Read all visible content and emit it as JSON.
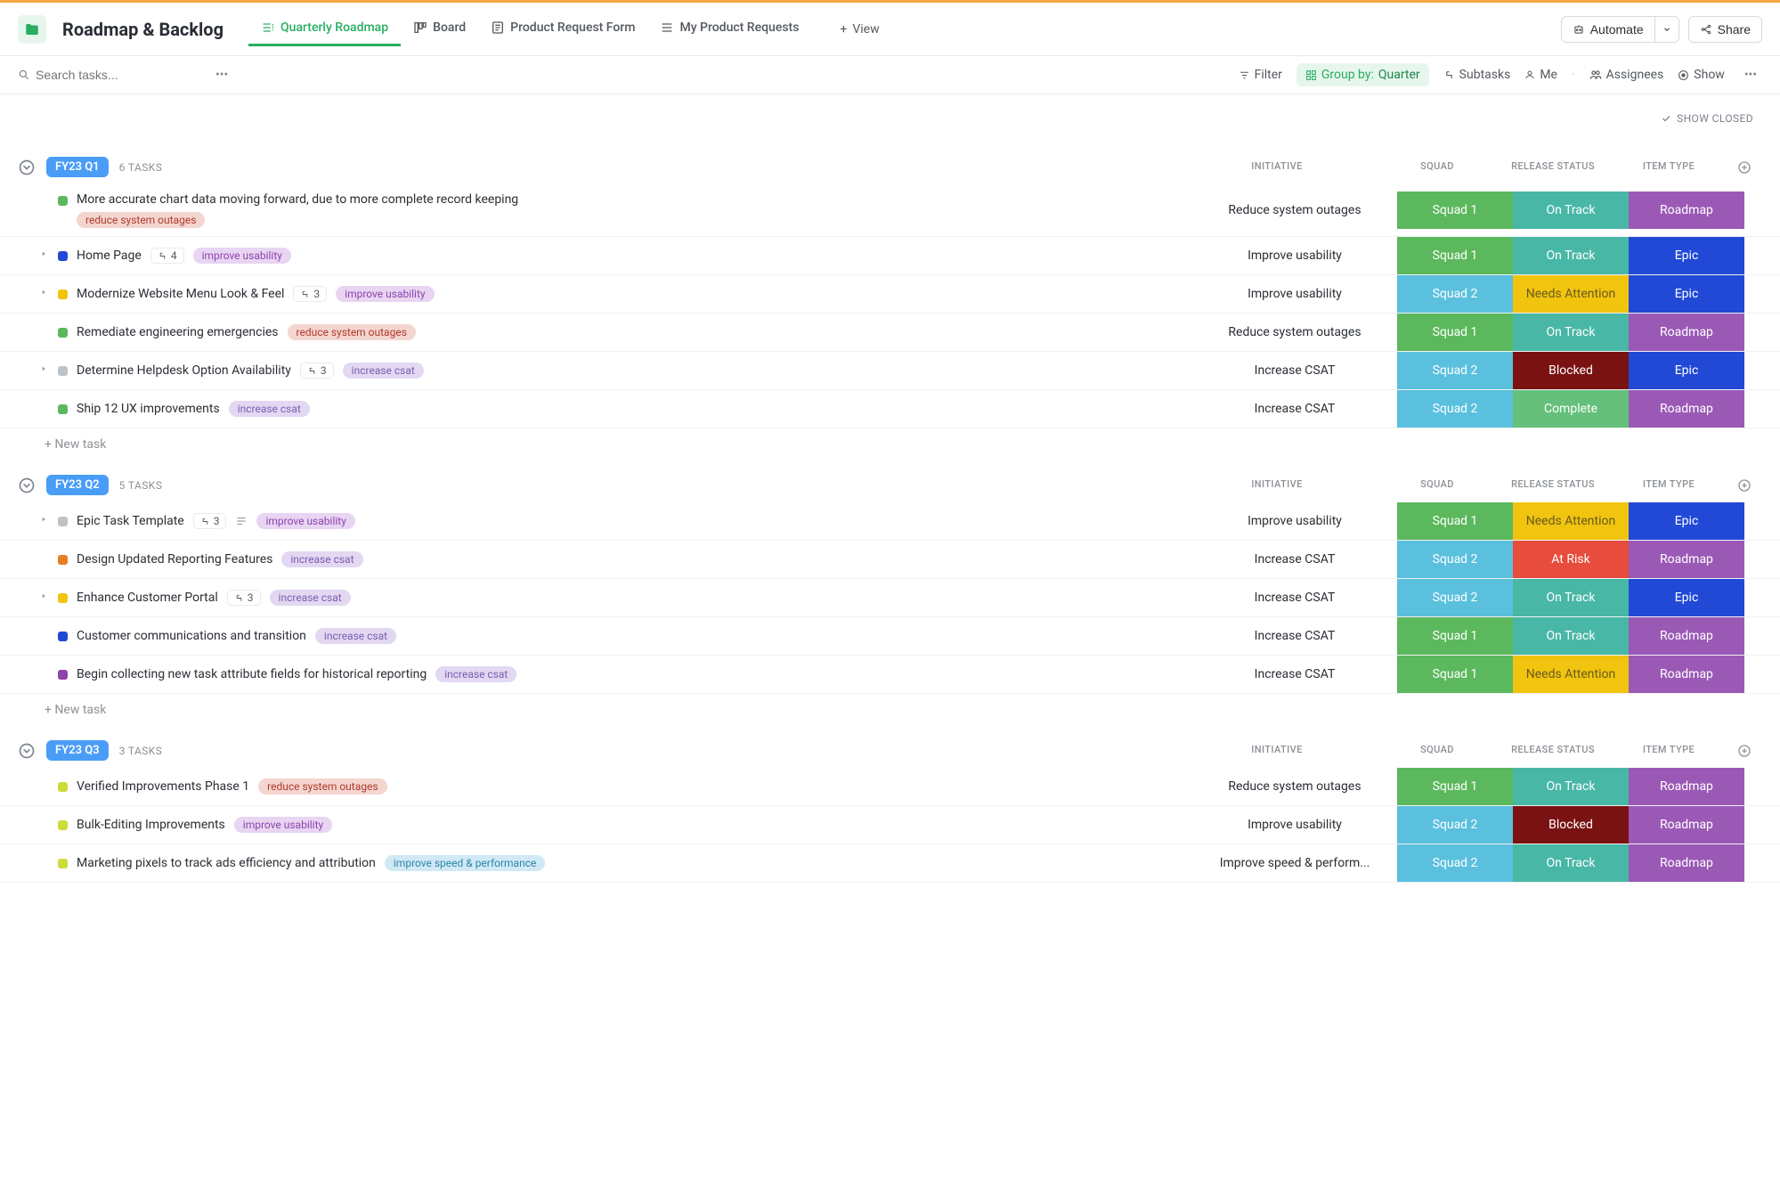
{
  "page_title": "Roadmap & Backlog",
  "tabs": [
    {
      "label": "Quarterly Roadmap",
      "active": true
    },
    {
      "label": "Board",
      "active": false
    },
    {
      "label": "Product Request Form",
      "active": false
    },
    {
      "label": "My Product Requests",
      "active": false
    }
  ],
  "add_view_label": "View",
  "header_buttons": {
    "automate": "Automate",
    "share": "Share"
  },
  "search_placeholder": "Search tasks...",
  "toolbar": {
    "filter": "Filter",
    "groupby_label": "Group by:",
    "groupby_value": "Quarter",
    "subtasks": "Subtasks",
    "me": "Me",
    "assignees": "Assignees",
    "show": "Show"
  },
  "show_closed": "SHOW CLOSED",
  "columns": {
    "initiative": "INITIATIVE",
    "squad": "SQUAD",
    "release_status": "RELEASE STATUS",
    "item_type": "ITEM TYPE"
  },
  "new_task_label": "+ New task",
  "tag_labels": {
    "reduce": "reduce system outages",
    "improve_usability": "improve usability",
    "increase_csat": "increase csat",
    "improve_speed": "improve speed & performance"
  },
  "groups": [
    {
      "name": "FY23 Q1",
      "count_label": "6 TASKS",
      "tasks": [
        {
          "title": "More accurate chart data moving forward, due to more complete record keeping",
          "status_color": "#5cb85c",
          "caret": false,
          "subs": null,
          "desc": false,
          "tags": [
            "reduce"
          ],
          "tag_below": true,
          "initiative": "Reduce system outages",
          "squad": "Squad 1",
          "squad_c": "squad1",
          "release": "On Track",
          "release_c": "ontrack",
          "type": "Roadmap",
          "type_c": "roadmap-c"
        },
        {
          "title": "Home Page",
          "status_color": "#2249d6",
          "caret": true,
          "subs": "4",
          "desc": false,
          "tags": [
            "improve_usability"
          ],
          "tag_below": false,
          "initiative": "Improve usability",
          "squad": "Squad 1",
          "squad_c": "squad1",
          "release": "On Track",
          "release_c": "ontrack",
          "type": "Epic",
          "type_c": "epic-c"
        },
        {
          "title": "Modernize Website Menu Look & Feel",
          "status_color": "#f1c40f",
          "caret": true,
          "subs": "3",
          "desc": false,
          "tags": [
            "improve_usability"
          ],
          "tag_below": false,
          "initiative": "Improve usability",
          "squad": "Squad 2",
          "squad_c": "squad2",
          "release": "Needs Attention",
          "release_c": "needs",
          "type": "Epic",
          "type_c": "epic-c"
        },
        {
          "title": "Remediate engineering emergencies",
          "status_color": "#5cb85c",
          "caret": false,
          "subs": null,
          "desc": false,
          "tags": [
            "reduce"
          ],
          "tag_below": false,
          "initiative": "Reduce system outages",
          "squad": "Squad 1",
          "squad_c": "squad1",
          "release": "On Track",
          "release_c": "ontrack",
          "type": "Roadmap",
          "type_c": "roadmap-c"
        },
        {
          "title": "Determine Helpdesk Option Availability",
          "status_color": "#bdc3c7",
          "caret": true,
          "subs": "3",
          "desc": false,
          "tags": [
            "increase_csat"
          ],
          "tag_below": false,
          "initiative": "Increase CSAT",
          "squad": "Squad 2",
          "squad_c": "squad2",
          "release": "Blocked",
          "release_c": "blocked",
          "type": "Epic",
          "type_c": "epic-c"
        },
        {
          "title": "Ship 12 UX improvements",
          "status_color": "#5cb85c",
          "caret": false,
          "subs": null,
          "desc": false,
          "tags": [
            "increase_csat"
          ],
          "tag_below": false,
          "initiative": "Increase CSAT",
          "squad": "Squad 2",
          "squad_c": "squad2",
          "release": "Complete",
          "release_c": "complete",
          "type": "Roadmap",
          "type_c": "roadmap-c"
        }
      ]
    },
    {
      "name": "FY23 Q2",
      "count_label": "5 TASKS",
      "tasks": [
        {
          "title": "Epic Task Template",
          "status_color": "#bdc3c7",
          "caret": true,
          "subs": "3",
          "desc": true,
          "tags": [
            "improve_usability"
          ],
          "tag_below": false,
          "initiative": "Improve usability",
          "squad": "Squad 1",
          "squad_c": "squad1",
          "release": "Needs Attention",
          "release_c": "needs",
          "type": "Epic",
          "type_c": "epic-c"
        },
        {
          "title": "Design Updated Reporting Features",
          "status_color": "#e67e22",
          "caret": false,
          "subs": null,
          "desc": false,
          "tags": [
            "increase_csat"
          ],
          "tag_below": false,
          "initiative": "Increase CSAT",
          "squad": "Squad 2",
          "squad_c": "squad2",
          "release": "At Risk",
          "release_c": "atrisk",
          "type": "Roadmap",
          "type_c": "roadmap-c"
        },
        {
          "title": "Enhance Customer Portal",
          "status_color": "#f1c40f",
          "caret": true,
          "subs": "3",
          "desc": false,
          "tags": [
            "increase_csat"
          ],
          "tag_below": false,
          "initiative": "Increase CSAT",
          "squad": "Squad 2",
          "squad_c": "squad2",
          "release": "On Track",
          "release_c": "ontrack",
          "type": "Epic",
          "type_c": "epic-c"
        },
        {
          "title": "Customer communications and transition",
          "status_color": "#2249d6",
          "caret": false,
          "subs": null,
          "desc": false,
          "tags": [
            "increase_csat"
          ],
          "tag_below": false,
          "initiative": "Increase CSAT",
          "squad": "Squad 1",
          "squad_c": "squad1",
          "release": "On Track",
          "release_c": "ontrack",
          "type": "Roadmap",
          "type_c": "roadmap-c"
        },
        {
          "title": "Begin collecting new task attribute fields for historical reporting",
          "status_color": "#8e44ad",
          "caret": false,
          "subs": null,
          "desc": false,
          "tags": [
            "increase_csat"
          ],
          "tag_below": false,
          "initiative": "Increase CSAT",
          "squad": "Squad 1",
          "squad_c": "squad1",
          "release": "Needs Attention",
          "release_c": "needs",
          "type": "Roadmap",
          "type_c": "roadmap-c"
        }
      ]
    },
    {
      "name": "FY23 Q3",
      "count_label": "3 TASKS",
      "tasks": [
        {
          "title": "Verified Improvements Phase 1",
          "status_color": "#cddc39",
          "caret": false,
          "subs": null,
          "desc": false,
          "tags": [
            "reduce"
          ],
          "tag_below": false,
          "initiative": "Reduce system outages",
          "squad": "Squad 1",
          "squad_c": "squad1",
          "release": "On Track",
          "release_c": "ontrack",
          "type": "Roadmap",
          "type_c": "roadmap-c"
        },
        {
          "title": "Bulk-Editing Improvements",
          "status_color": "#cddc39",
          "caret": false,
          "subs": null,
          "desc": false,
          "tags": [
            "improve_usability"
          ],
          "tag_below": false,
          "initiative": "Improve usability",
          "squad": "Squad 2",
          "squad_c": "squad2",
          "release": "Blocked",
          "release_c": "blocked",
          "type": "Roadmap",
          "type_c": "roadmap-c"
        },
        {
          "title": "Marketing pixels to track ads efficiency and attribution",
          "status_color": "#cddc39",
          "caret": false,
          "subs": null,
          "desc": false,
          "tags": [
            "improve_speed"
          ],
          "tag_below": false,
          "initiative": "Improve speed & perform...",
          "squad": "Squad 2",
          "squad_c": "squad2",
          "release": "On Track",
          "release_c": "ontrack",
          "type": "Roadmap",
          "type_c": "roadmap-c"
        }
      ]
    }
  ]
}
